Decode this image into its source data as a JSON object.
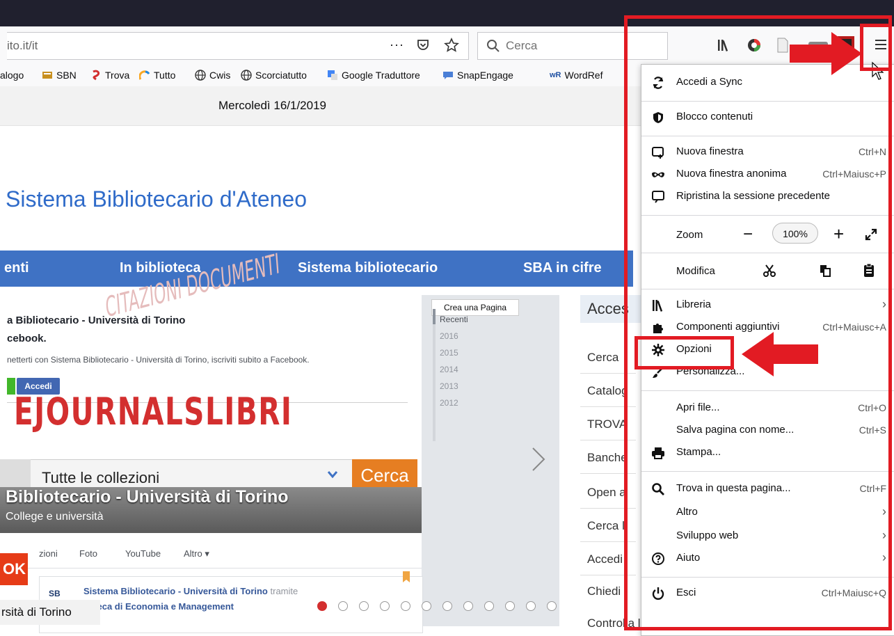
{
  "browser": {
    "url_text": "ito.it/it",
    "url_more": "···",
    "search_placeholder": "Cerca"
  },
  "bookmarks": [
    {
      "label": "alogo"
    },
    {
      "label": "SBN"
    },
    {
      "label": "Trova"
    },
    {
      "label": "Tutto"
    },
    {
      "label": "Cwis"
    },
    {
      "label": "Scorciatutto"
    },
    {
      "label": "Google Traduttore"
    },
    {
      "label": "SnapEngage"
    },
    {
      "label": "WordRef"
    }
  ],
  "page": {
    "date": "Mercoledì 16/1/2019",
    "title": "Sistema Bibliotecario d'Ateneo",
    "nav": [
      "enti",
      "In biblioteca",
      "Sistema bibliotecario",
      "SBA in cifre"
    ],
    "fb_title": "a Bibliotecario - Università di Torino",
    "fb_sub": "cebook.",
    "fb_text": "netterti con Sistema Bibliotecario - Università di Torino, iscriviti subito a Facebook.",
    "fb_button": "Accedi",
    "big_word": "EJOURNALSLIBRI",
    "watermark": "CITAZIONI DOCUMENTI",
    "crea_pagina": "Crea una Pagina",
    "years": [
      "Recenti",
      "2016",
      "2015",
      "2014",
      "2013",
      "2012"
    ],
    "collections": "Tutte le collezioni",
    "search_button": "Cerca",
    "band_title": "Bibliotecario - Università di Torino",
    "band_sub": "College e università",
    "fb_tabs": [
      "zioni",
      "Foto",
      "YouTube",
      "Altro ▾"
    ],
    "ok_label": "OK",
    "post_title": "Sistema Bibliotecario - Università di Torino",
    "post_tramite": "tramite",
    "post_sub": "lioteca di Economia e Management",
    "unito_label": "rsità di Torino",
    "accesso": "Acces",
    "access_items": [
      "Cerca",
      "Catalog",
      "TROVA",
      "Banche",
      "Open a",
      "Cerca l",
      "Accedi",
      "Chiedi",
      "Controlla la tua situazione prestiti"
    ]
  },
  "menu": {
    "sync": "Accedi a Sync",
    "blocco": "Blocco contenuti",
    "nuova_finestra": "Nuova finestra",
    "nuova_finestra_sc": "Ctrl+N",
    "anonima": "Nuova finestra anonima",
    "anonima_sc": "Ctrl+Maiusc+P",
    "ripristina": "Ripristina la sessione precedente",
    "zoom": "Zoom",
    "zoom_minus": "−",
    "zoom_value": "100%",
    "zoom_plus": "+",
    "modifica": "Modifica",
    "libreria": "Libreria",
    "componenti": "Componenti aggiuntivi",
    "componenti_sc": "Ctrl+Maiusc+A",
    "opzioni": "Opzioni",
    "personalizza": "Personalizza...",
    "apri": "Apri file...",
    "apri_sc": "Ctrl+O",
    "salva": "Salva pagina con nome...",
    "salva_sc": "Ctrl+S",
    "stampa": "Stampa...",
    "trova": "Trova in questa pagina...",
    "trova_sc": "Ctrl+F",
    "altro": "Altro",
    "sviluppo": "Sviluppo web",
    "aiuto": "Aiuto",
    "esci": "Esci",
    "esci_sc": "Ctrl+Maiusc+Q",
    "chevron": "›"
  },
  "colors": {
    "annotation_red": "#e21b23",
    "nav_blue": "#3f72c4"
  }
}
